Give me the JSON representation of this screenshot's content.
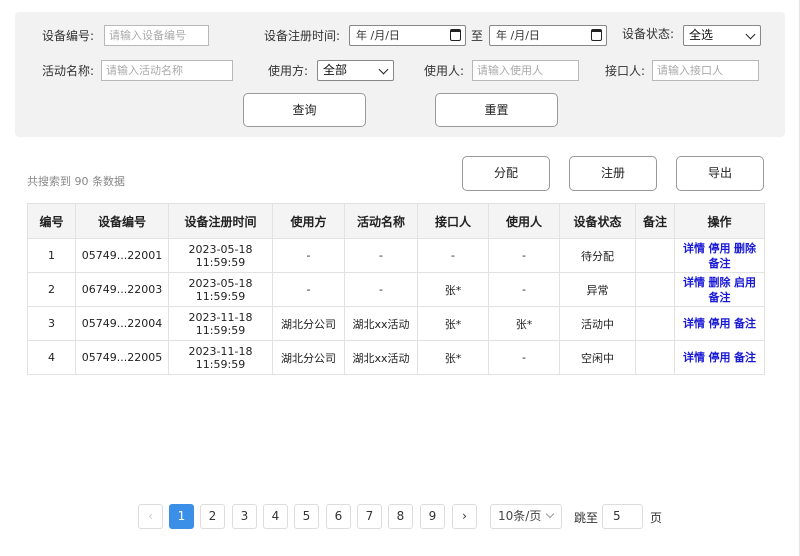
{
  "filters": {
    "device_no_label": "设备编号:",
    "device_no_placeholder": "请输入设备编号",
    "reg_time_label": "设备注册时间:",
    "date_start": "年 /月/日",
    "date_sep": "至",
    "date_end": "年 /月/日",
    "status_label": "设备状态:",
    "status_value": "全选",
    "activity_label": "活动名称:",
    "activity_placeholder": "请输入活动名称",
    "user_party_label": "使用方:",
    "user_party_value": "全部",
    "user_label": "使用人:",
    "user_placeholder": "请输入使用人",
    "contact_label": "接口人:",
    "contact_placeholder": "请输入接口人",
    "query_btn": "查询",
    "reset_btn": "重置"
  },
  "toolbar": {
    "count_text": "共搜索到 90 条数据",
    "assign_btn": "分配",
    "register_btn": "注册",
    "export_btn": "导出"
  },
  "table": {
    "headers": [
      "编号",
      "设备编号",
      "设备注册时间",
      "使用方",
      "活动名称",
      "接口人",
      "使用人",
      "设备状态",
      "备注",
      "操作"
    ],
    "rows": [
      {
        "no": "1",
        "device": "05749...22001",
        "time": "2023-05-18 11:59:59",
        "party": "-",
        "activity": "-",
        "contact": "-",
        "user": "-",
        "status": "待分配",
        "remark": "",
        "ops": [
          "详情",
          "停用",
          "删除",
          "备注"
        ]
      },
      {
        "no": "2",
        "device": "06749...22003",
        "time": "2023-05-18 11:59:59",
        "party": "-",
        "activity": "-",
        "contact": "张*",
        "user": "-",
        "status": "异常",
        "remark": "",
        "ops": [
          "详情",
          "删除",
          "启用",
          "备注"
        ]
      },
      {
        "no": "3",
        "device": "05749...22004",
        "time": "2023-11-18 11:59:59",
        "party": "湖北分公司",
        "activity": "湖北xx活动",
        "contact": "张*",
        "user": "张*",
        "status": "活动中",
        "remark": "",
        "ops": [
          "详情",
          "停用",
          "备注"
        ]
      },
      {
        "no": "4",
        "device": "05749...22005",
        "time": "2023-11-18 11:59:59",
        "party": "湖北分公司",
        "activity": "湖北xx活动",
        "contact": "张*",
        "user": "-",
        "status": "空闲中",
        "remark": "",
        "ops": [
          "详情",
          "停用",
          "备注"
        ]
      }
    ]
  },
  "pagination": {
    "prev": "‹",
    "next": "›",
    "pages": [
      "1",
      "2",
      "3",
      "4",
      "5",
      "6",
      "7",
      "8",
      "9"
    ],
    "active": "1",
    "page_size": "10条/页",
    "jump_label": "跳至",
    "jump_value": "5",
    "page_suffix": "页"
  }
}
